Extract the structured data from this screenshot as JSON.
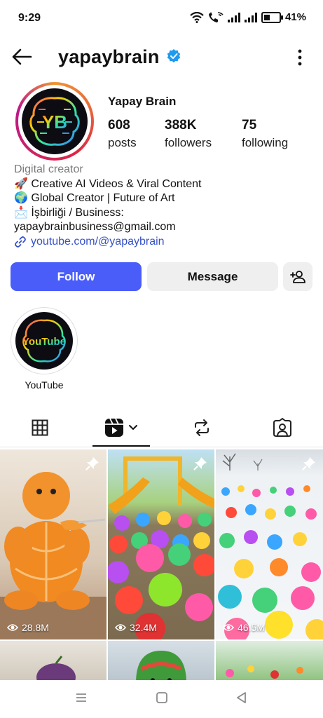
{
  "status_bar": {
    "time": "9:29",
    "battery": "41%"
  },
  "header": {
    "username": "yapaybrain"
  },
  "profile": {
    "avatar_text": "YB",
    "name": "Yapay Brain",
    "stats": [
      {
        "value": "608",
        "label": "posts"
      },
      {
        "value": "388K",
        "label": "followers"
      },
      {
        "value": "75",
        "label": "following"
      }
    ],
    "category": "Digital creator",
    "bio_lines": [
      "🚀 Creative AI Videos & Viral Content",
      "🌍 Global Creator | Future of Art",
      "📩 İşbirliği / Business:",
      "yapaybrainbusiness@gmail.com"
    ],
    "link": "youtube.com/@yapaybrain"
  },
  "actions": {
    "follow": "Follow",
    "message": "Message"
  },
  "highlights": [
    {
      "label": "YouTube",
      "logo_text": "YouTube"
    }
  ],
  "grid": [
    {
      "views": "28.8M",
      "pinned": true
    },
    {
      "views": "32.4M",
      "pinned": true
    },
    {
      "views": "46.5M",
      "pinned": true
    }
  ],
  "colors": {
    "accent": "#4a5df9",
    "verified": "#1d9bf0",
    "link": "#3751c7"
  }
}
